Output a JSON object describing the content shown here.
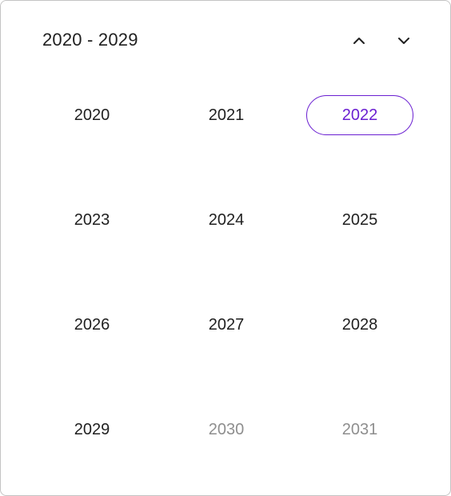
{
  "header": {
    "range_label": "2020 - 2029",
    "prev_icon": "chevron-up-icon",
    "next_icon": "chevron-down-icon"
  },
  "years": [
    {
      "label": "2020",
      "state": "normal"
    },
    {
      "label": "2021",
      "state": "normal"
    },
    {
      "label": "2022",
      "state": "selected"
    },
    {
      "label": "2023",
      "state": "normal"
    },
    {
      "label": "2024",
      "state": "normal"
    },
    {
      "label": "2025",
      "state": "normal"
    },
    {
      "label": "2026",
      "state": "normal"
    },
    {
      "label": "2027",
      "state": "normal"
    },
    {
      "label": "2028",
      "state": "normal"
    },
    {
      "label": "2029",
      "state": "normal"
    },
    {
      "label": "2030",
      "state": "muted"
    },
    {
      "label": "2031",
      "state": "muted"
    }
  ],
  "colors": {
    "accent": "#6a1fd1",
    "text": "#1f1f1f",
    "muted": "#8e8e8e",
    "border": "#c4c4c4"
  }
}
